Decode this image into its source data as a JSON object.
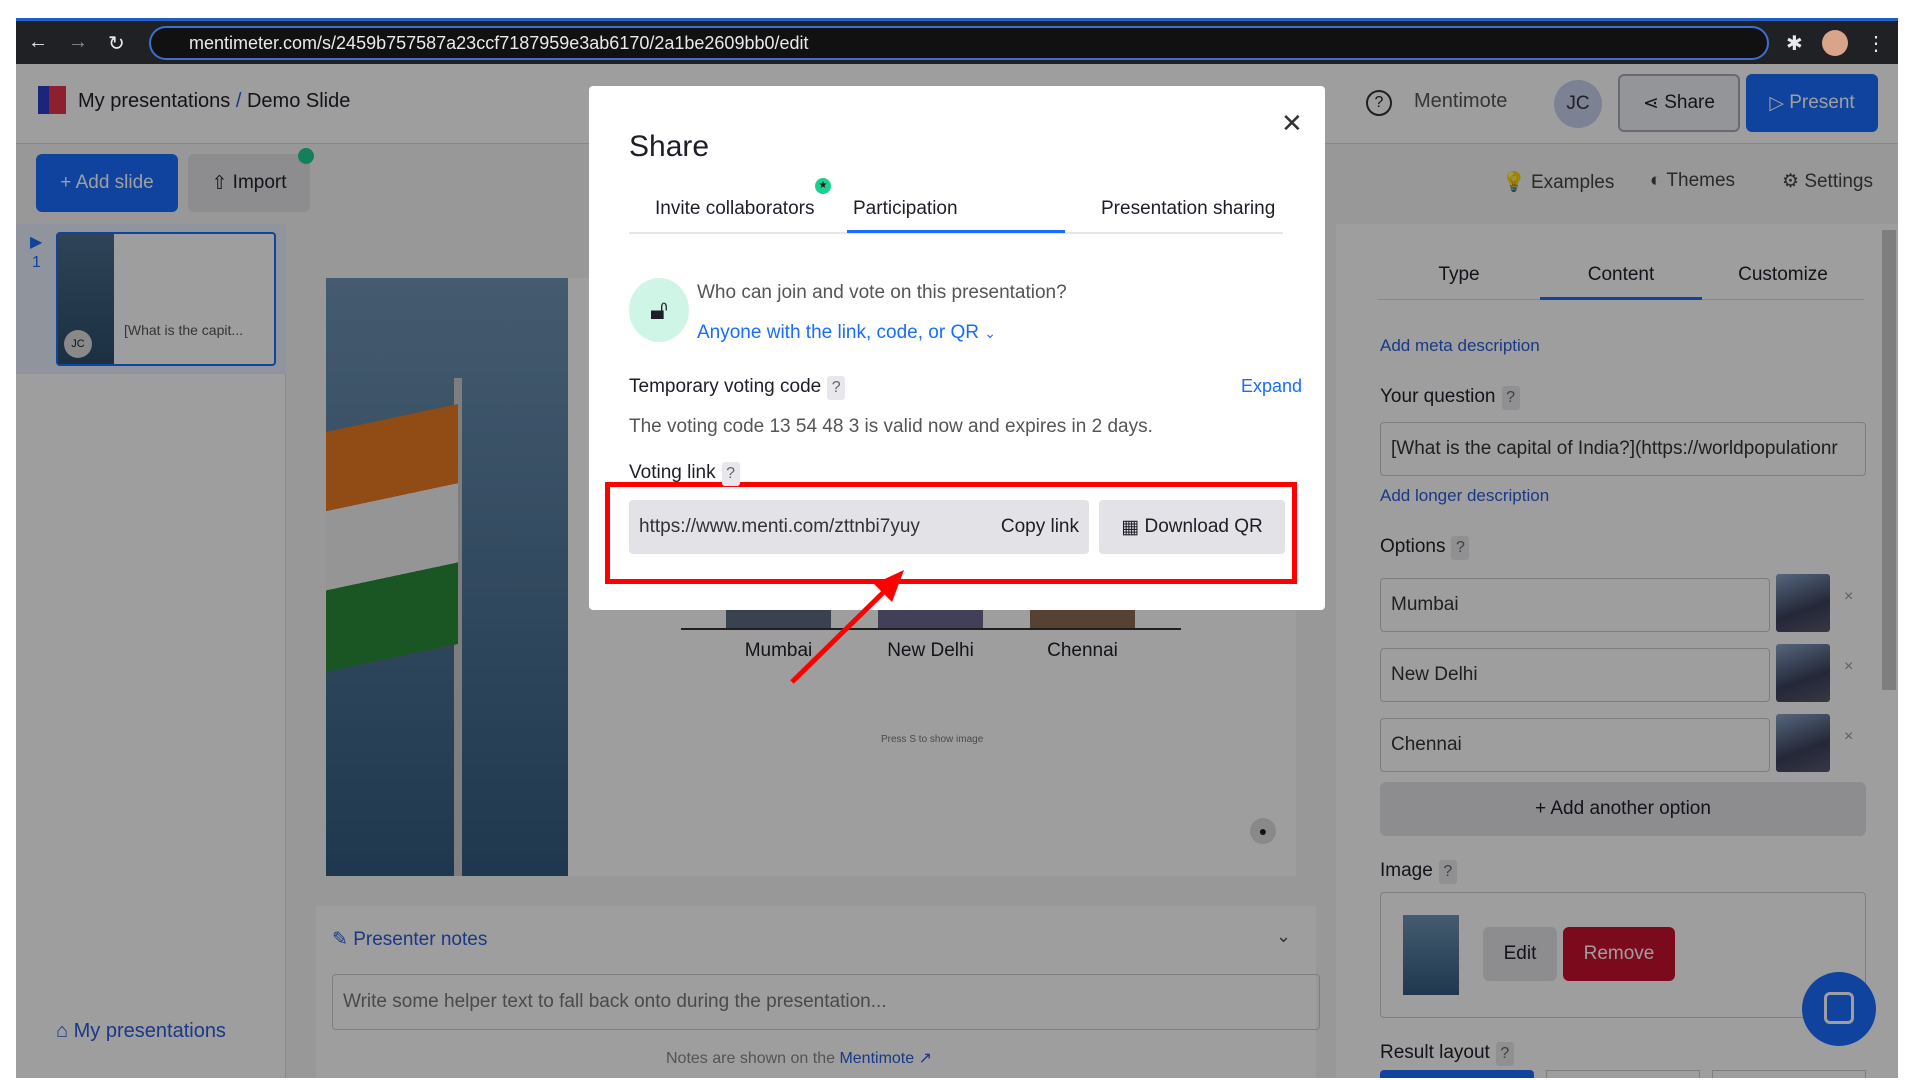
{
  "browser": {
    "url": "mentimeter.com/s/2459b757587a23ccf7187959e3ab6170/2a1be2609bb0/edit"
  },
  "header": {
    "breadcrumb_root": "My presentations",
    "breadcrumb_sep": "/",
    "breadcrumb_current": "Demo Slide",
    "mentimote": "Mentimote",
    "avatar": "JC",
    "share": "Share",
    "present": "Present"
  },
  "toolbar": {
    "add_slide": "+ Add slide",
    "import": "Import",
    "examples": "Examples",
    "themes": "Themes",
    "settings": "Settings"
  },
  "slides": [
    {
      "number": "1",
      "title": "[What is the capit...",
      "avatar": "JC"
    }
  ],
  "sidebar": {
    "my_presentations": "My presentations"
  },
  "canvas": {
    "options": [
      "Mumbai",
      "New Delhi",
      "Chennai"
    ],
    "hint": "Press S to show image"
  },
  "notes": {
    "title": "Presenter notes",
    "placeholder": "Write some helper text to fall back onto during the presentation...",
    "footer": "Notes are shown on the",
    "footer_link": "Mentimote"
  },
  "panel": {
    "tabs": [
      "Type",
      "Content",
      "Customize"
    ],
    "add_meta": "Add meta description",
    "your_question": "Your question",
    "question_value": "[What is the capital of India?](https://worldpopulationr",
    "add_longer": "Add longer description",
    "options_label": "Options",
    "options": [
      "Mumbai",
      "New Delhi",
      "Chennai"
    ],
    "add_option": "+ Add another option",
    "image_label": "Image",
    "edit": "Edit",
    "remove": "Remove",
    "result_layout": "Result layout"
  },
  "modal": {
    "title": "Share",
    "tabs": [
      "Invite collaborators",
      "Participation",
      "Presentation sharing"
    ],
    "active_tab": 1,
    "who_question": "Who can join and vote on this presentation?",
    "who_value": "Anyone with the link, code, or QR",
    "temp_code_label": "Temporary voting code",
    "expand": "Expand",
    "code_text": "The voting code 13 54 48 3 is valid now and expires in 2 days.",
    "voting_link_label": "Voting link",
    "voting_link": "https://www.menti.com/zttnbi7yuy",
    "copy_link": "Copy link",
    "download_qr": "Download QR",
    "help": "?"
  },
  "colors": {
    "accent": "#196cff",
    "remove": "#c8102e",
    "highlight": "#ff0000"
  }
}
